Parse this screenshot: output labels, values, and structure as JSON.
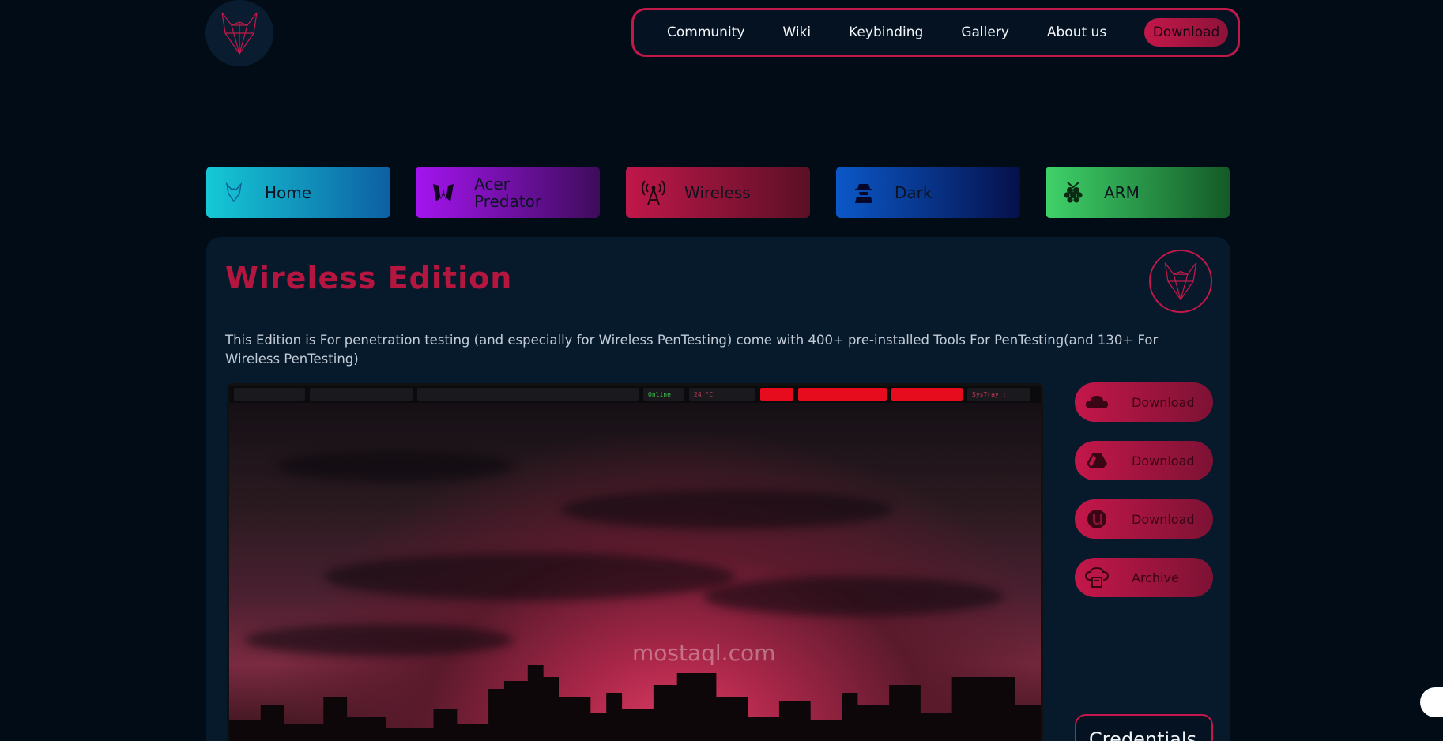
{
  "nav": {
    "items": [
      "Community",
      "Wiki",
      "Keybinding",
      "Gallery",
      "About us"
    ],
    "download_label": "Download"
  },
  "tabs": [
    {
      "label": "Home",
      "icon": "wolf-icon"
    },
    {
      "label": "Acer Predator",
      "icon": "predator-icon"
    },
    {
      "label": "Wireless",
      "icon": "antenna-icon"
    },
    {
      "label": "Dark",
      "icon": "hacker-icon"
    },
    {
      "label": "ARM",
      "icon": "raspberry-icon"
    }
  ],
  "panel": {
    "title": "Wireless Edition",
    "description": "This Edition is For penetration testing (and especially for Wireless PenTesting) come with 400+ pre-installed Tools For PenTesting(and 130+ For Wireless PenTesting)"
  },
  "preview_bar": {
    "cpu": "24 °C",
    "status": "Online",
    "systray": "SysTray :"
  },
  "side_buttons": [
    {
      "label": "Download",
      "icon": "cloud-icon"
    },
    {
      "label": "Download",
      "icon": "google-drive-icon"
    },
    {
      "label": "Download",
      "icon": "utorrent-icon"
    },
    {
      "label": "Archive",
      "icon": "cloud-archive-icon"
    }
  ],
  "credentials_label": "Credentials",
  "watermark": "mostaql.com",
  "colors": {
    "accent": "#c2184a",
    "background": "#020c17",
    "panel": "#061a2c"
  }
}
